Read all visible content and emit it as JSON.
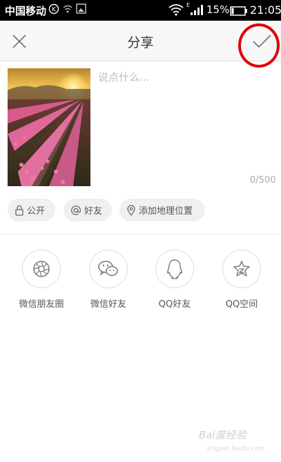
{
  "status_bar": {
    "carrier": "中国移动",
    "battery_percent": "15%",
    "time": "21:05",
    "signal_type": "E",
    "icons": [
      "roaming-icon",
      "wifi-small-icon",
      "image-icon",
      "wifi-icon",
      "signal-icon",
      "battery-icon"
    ]
  },
  "header": {
    "title": "分享",
    "close_icon": "close-icon",
    "confirm_icon": "check-icon"
  },
  "compose": {
    "placeholder": "说点什么...",
    "counter": "0/500"
  },
  "options": [
    {
      "label": "公开",
      "icon": "lock-icon"
    },
    {
      "label": "好友",
      "icon": "at-icon"
    },
    {
      "label": "添加地理位置",
      "icon": "location-icon"
    }
  ],
  "share_targets": [
    {
      "label": "微信朋友圈",
      "icon": "wechat-moments-icon"
    },
    {
      "label": "微信好友",
      "icon": "wechat-icon"
    },
    {
      "label": "QQ好友",
      "icon": "qq-icon"
    },
    {
      "label": "QQ空间",
      "icon": "qzone-icon"
    }
  ],
  "watermark": {
    "text": "Bai度经验",
    "sub": "jingyan.baidu.com"
  },
  "colors": {
    "highlight_ring": "#e00000",
    "header_bg": "#f7f7f7",
    "chip_bg": "#f0f0f0"
  }
}
